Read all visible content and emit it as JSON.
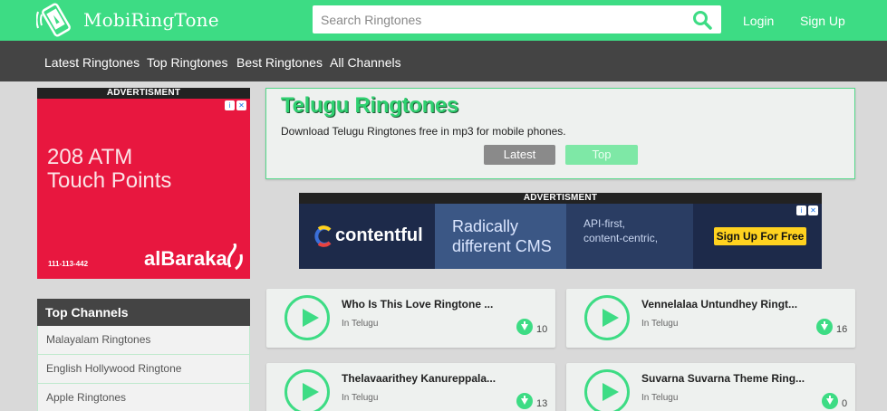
{
  "header": {
    "logo_text": "MobiRingTone",
    "search_placeholder": "Search Ringtones",
    "login": "Login",
    "signup": "Sign Up",
    "accent": "#3ddc84"
  },
  "nav": {
    "items": [
      "Latest Ringtones",
      "Top Ringtones",
      "Best Ringtones",
      "All Channels"
    ]
  },
  "ad_left": {
    "label": "ADVERTISMENT",
    "headline_line1": "208 ATM",
    "headline_line2": "Touch Points",
    "phone": "111-113-442",
    "brand": "alBaraka",
    "bg": "#e8173f"
  },
  "channels": {
    "title": "Top Channels",
    "items": [
      "Malayalam Ringtones",
      "English Hollywood Ringtone",
      "Apple Ringtones"
    ]
  },
  "main": {
    "title": "Telugu Ringtones",
    "description": "Download Telugu Ringtones free in mp3 for mobile phones.",
    "btn_latest": "Latest",
    "btn_top": "Top"
  },
  "ad_mid": {
    "label": "ADVERTISMENT",
    "brand": "contentful",
    "headline_line1": "Radically",
    "headline_line2": "different CMS",
    "sub_line1": "API-first,",
    "sub_line2": "content-centric,",
    "cta": "Sign Up For Free"
  },
  "ringtones": [
    {
      "title": "Who Is This Love Ringtone ...",
      "category": "In Telugu",
      "downloads": "10"
    },
    {
      "title": "Vennelalaa Untundhey Ringt...",
      "category": "In Telugu",
      "downloads": "16"
    },
    {
      "title": "Thelavaarithey Kanureppala...",
      "category": "In Telugu",
      "downloads": "13"
    },
    {
      "title": "Suvarna Suvarna Theme Ring...",
      "category": "In Telugu",
      "downloads": "0"
    }
  ]
}
